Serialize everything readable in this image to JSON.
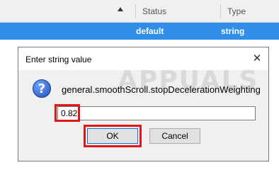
{
  "table": {
    "columns": {
      "status": "Status",
      "type": "Type"
    },
    "selected_row": {
      "status": "default",
      "type": "string"
    }
  },
  "dialog": {
    "title": "Enter string value",
    "close_glyph": "✕",
    "icon_glyph": "?",
    "pref_name": "general.smoothScroll.stopDecelerationWeighting",
    "value": "0.82",
    "ok_label": "OK",
    "cancel_label": "Cancel",
    "watermark": "APPUALS"
  },
  "colors": {
    "selection": "#2e8ee8",
    "highlight": "#e01616"
  }
}
